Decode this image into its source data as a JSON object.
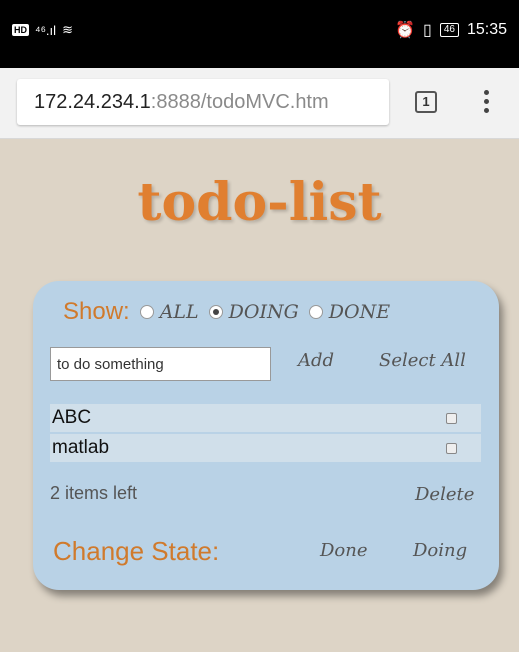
{
  "statusbar": {
    "left": "HD ⁴⁶.ıl ≋",
    "time": "15:35",
    "battery": "46"
  },
  "browser": {
    "url_host": "172.24.234.1",
    "url_rest": ":8888/todoMVC.htm",
    "tab_count": "1"
  },
  "app": {
    "title": "todo-list",
    "show_label": "Show:",
    "filters": [
      {
        "label": "ALL",
        "checked": false
      },
      {
        "label": "DOING",
        "checked": true
      },
      {
        "label": "DONE",
        "checked": false
      }
    ],
    "input": {
      "value": "to do something"
    },
    "add_label": "Add",
    "select_all_label": "Select All",
    "items": [
      {
        "text": "ABC"
      },
      {
        "text": "matlab"
      }
    ],
    "items_left": "2 items left",
    "delete_label": "Delete",
    "change_state_label": "Change State:",
    "done_label": "Done",
    "doing_label": "Doing"
  }
}
